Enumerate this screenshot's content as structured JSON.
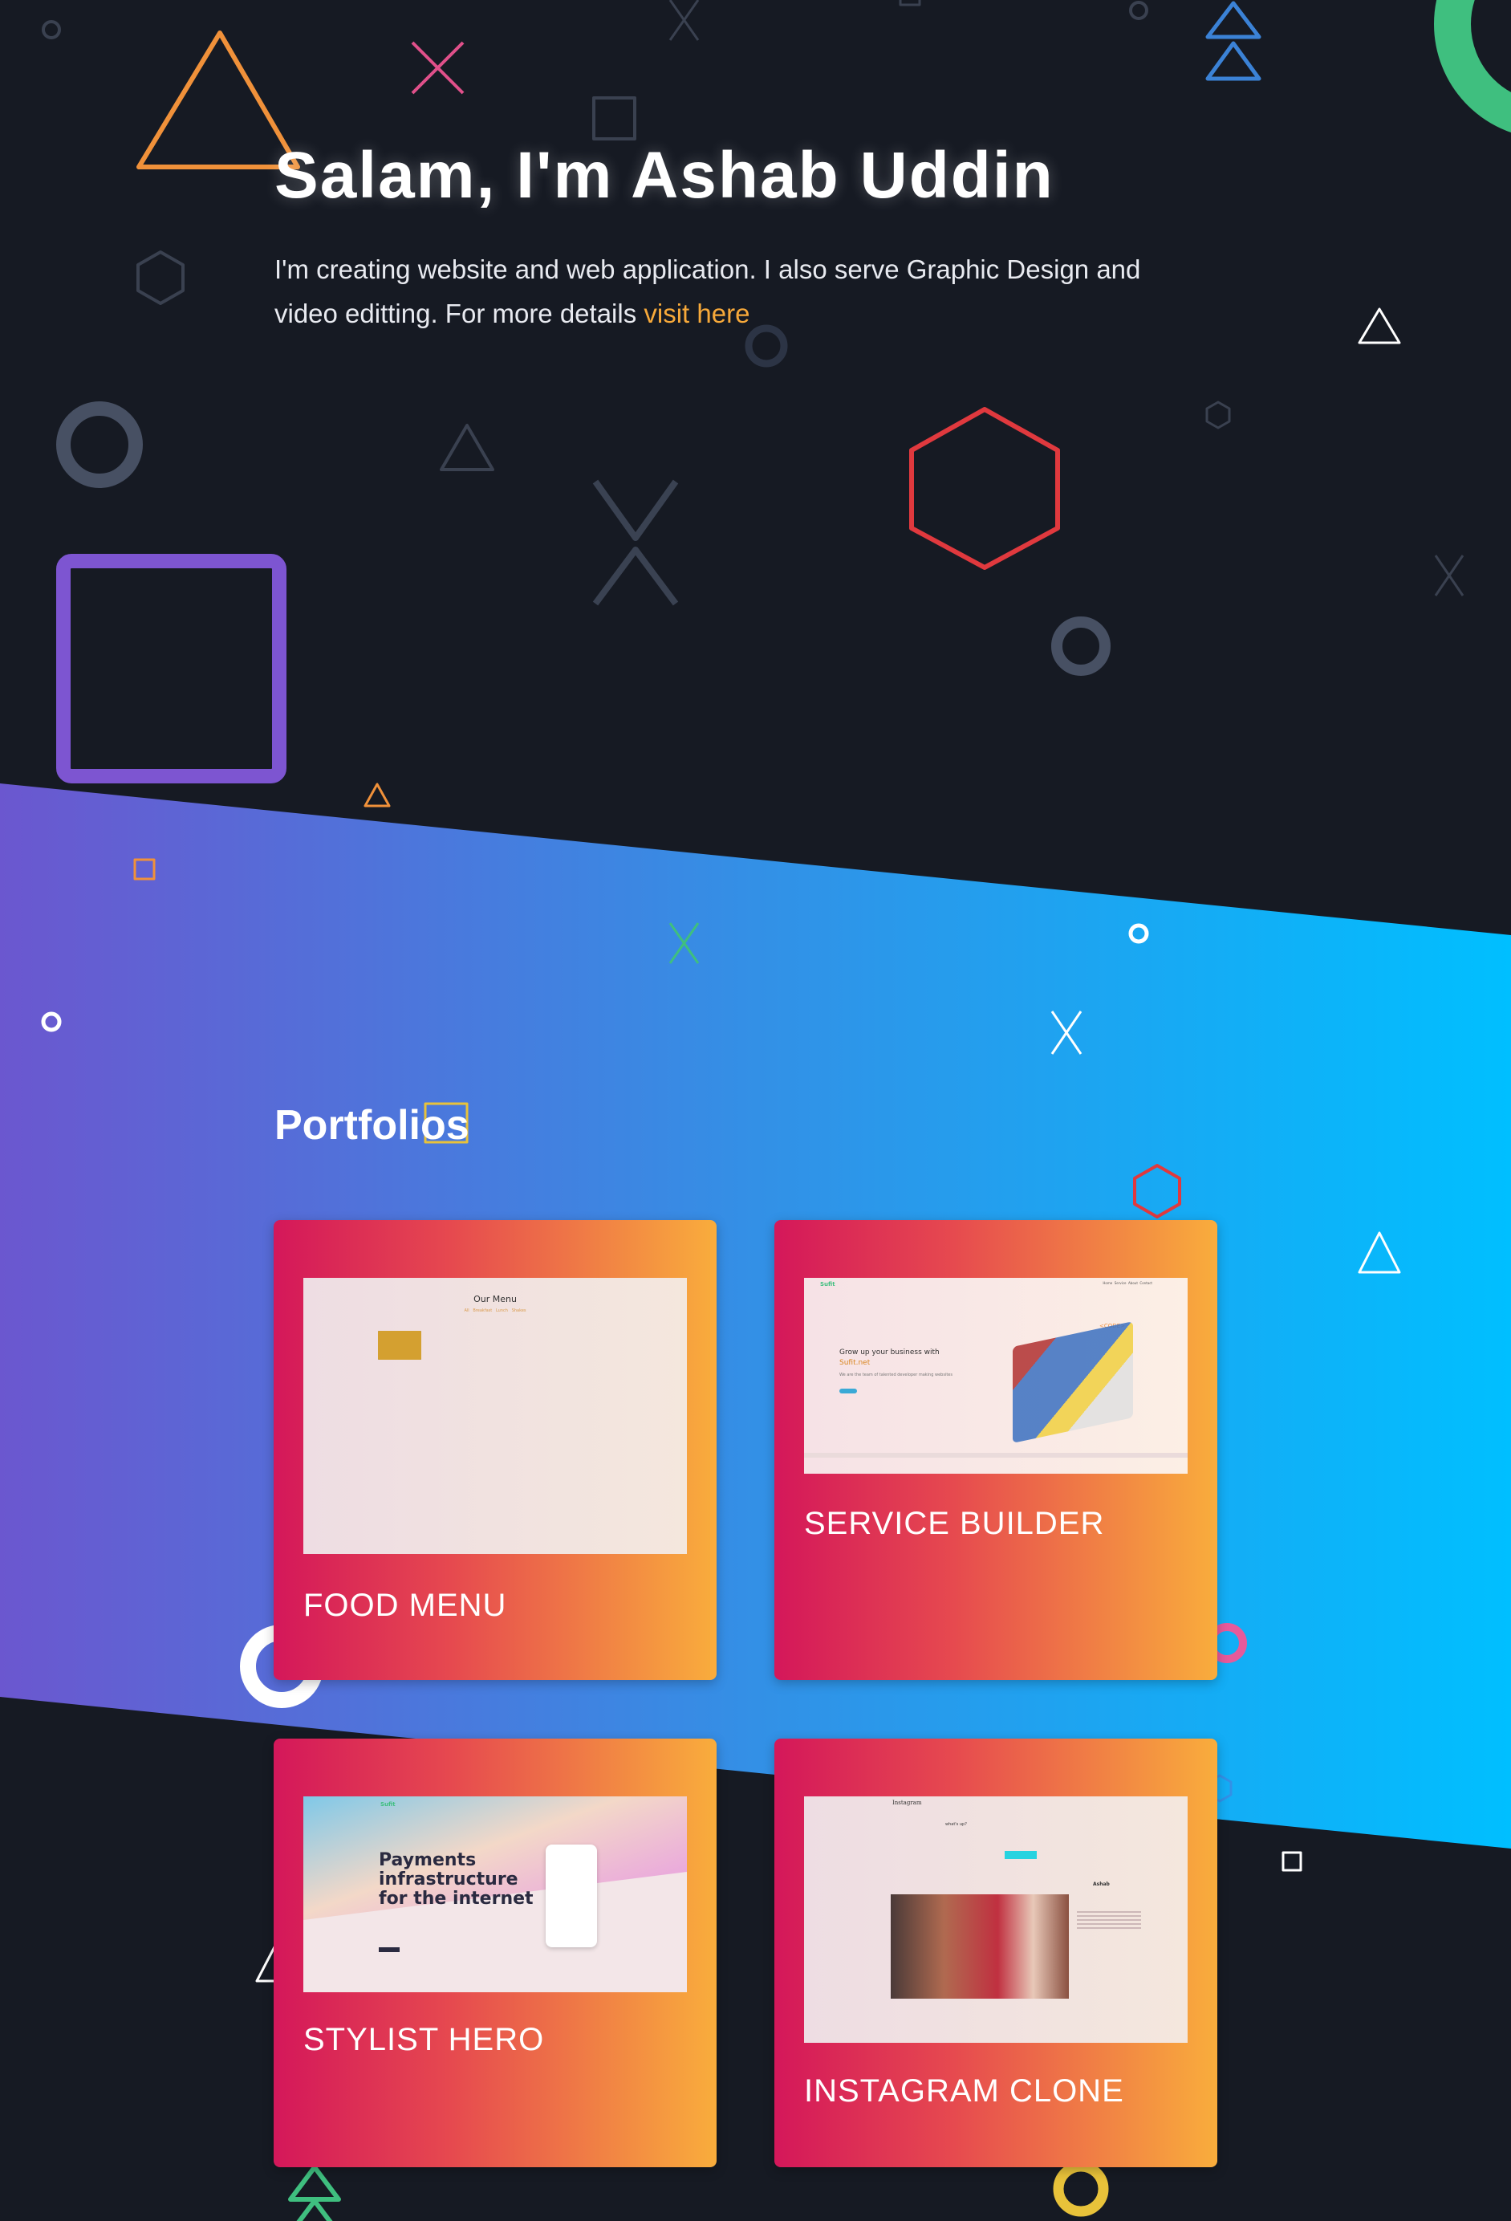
{
  "hero": {
    "title": "Salam, I'm Ashab Uddin",
    "text": "I'm creating website and web application. I also serve Graphic Design and video editting. For more details ",
    "link_label": "visit here"
  },
  "portfolio": {
    "heading": "Portfolios",
    "cards": [
      {
        "label": "FOOD MENU",
        "shot_title": "Our Menu",
        "shot_tabs": "All   Breakfast   Lunch   Shakes"
      },
      {
        "label": "SERVICE BUILDER",
        "shot_logo": "Sufit",
        "shot_nav": "Home  Service  About  Contact",
        "shot_heading": "Grow up your business with",
        "shot_brand": "Sufit.net",
        "shot_sub": "We are the team of talented developer making websites",
        "shot_tag": "<CODE>"
      },
      {
        "label": "STYLIST HERO",
        "shot_logo": "Sufit",
        "shot_heading": "Payments infrastructure for the internet"
      },
      {
        "label": "INSTAGRAM CLONE",
        "shot_logo": "Instagram",
        "shot_user": "Ashab",
        "shot_prompt": "what's up?"
      }
    ]
  },
  "colors": {
    "accent": "#f7a93a",
    "card_start": "#d4175a",
    "card_end": "#f9ad3c",
    "band_start": "#6b57cf",
    "band_end": "#00bfff",
    "background": "#161a23"
  }
}
